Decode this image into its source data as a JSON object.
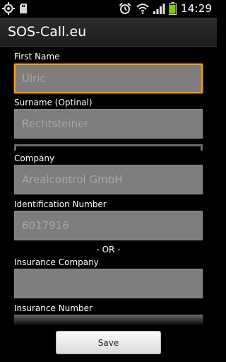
{
  "status_bar": {
    "time": "14:29",
    "icons": [
      "gps-icon",
      "sd-card-icon",
      "alarm-icon",
      "wifi-icon",
      "signal-icon",
      "battery-icon"
    ],
    "battery_color": "#7ccd00"
  },
  "app": {
    "title": "SOS-Call.eu"
  },
  "form": {
    "first_name": {
      "label": "First Name",
      "value": "Ulric"
    },
    "surname": {
      "label": "Surname (Optinal)",
      "value": "Rechtsteiner"
    },
    "company": {
      "label": "Company",
      "value": "Arealcontrol GmbH"
    },
    "identification_number": {
      "label": "Identification Number",
      "value": "6017916"
    },
    "or_separator": "- OR -",
    "insurance_company": {
      "label": "Insurance Company",
      "value": ""
    },
    "insurance_number": {
      "label": "Insurance Number",
      "value": ""
    }
  },
  "actions": {
    "save_label": "Save"
  },
  "colors": {
    "focus_accent": "#ff9c00",
    "field_background": "#7d7d7d"
  }
}
